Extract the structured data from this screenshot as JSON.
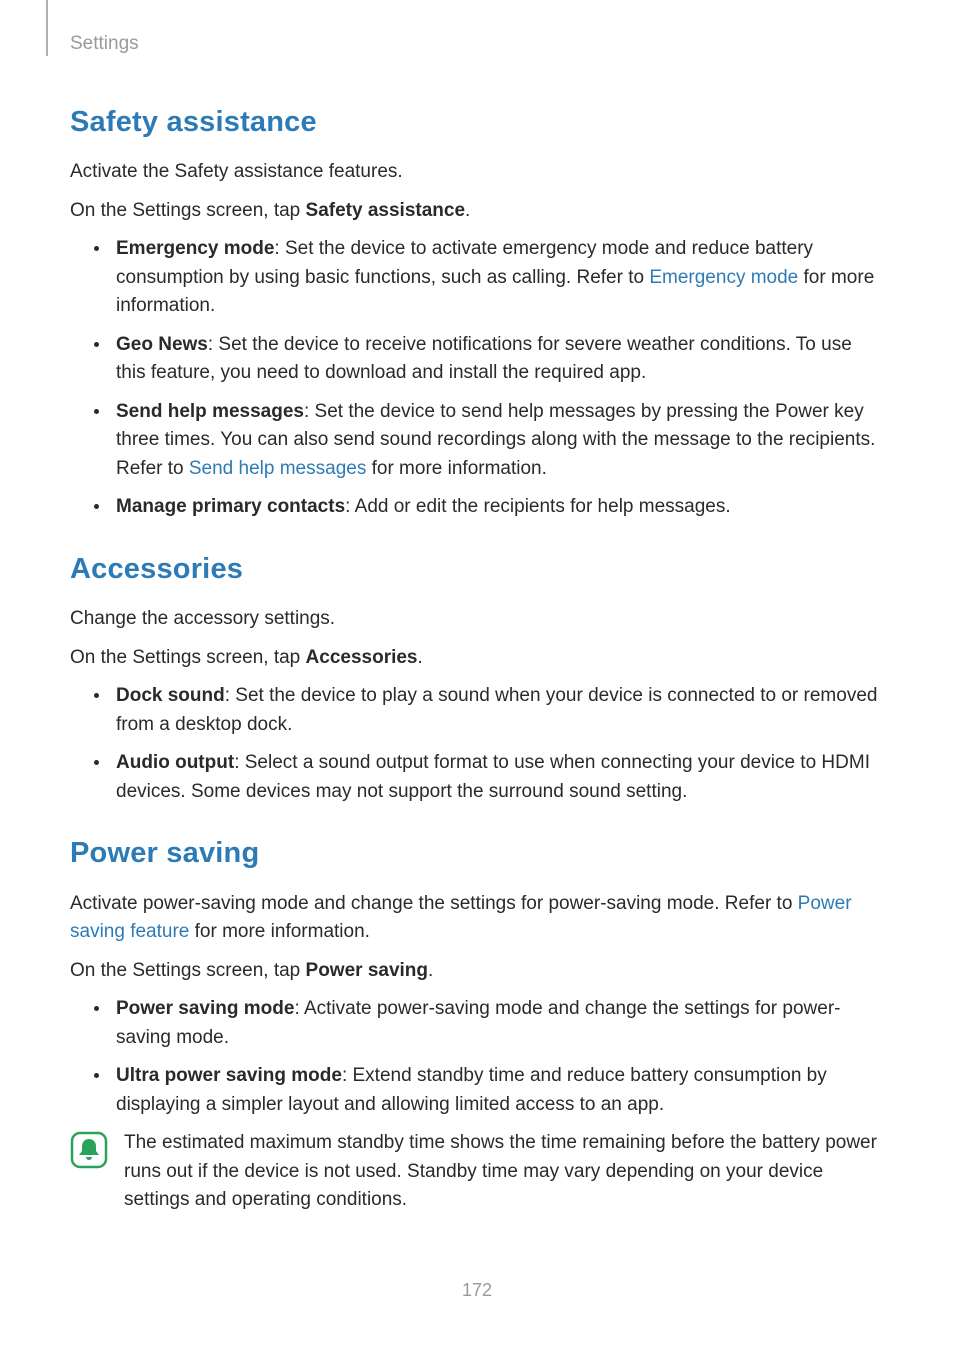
{
  "header": {
    "breadcrumb": "Settings"
  },
  "page_number": "172",
  "sections": {
    "safety": {
      "title": "Safety assistance",
      "intro": "Activate the Safety assistance features.",
      "nav_pre": "On the Settings screen, tap ",
      "nav_bold": "Safety assistance",
      "nav_post": ".",
      "items": {
        "emergency": {
          "label": "Emergency mode",
          "text_a": ": Set the device to activate emergency mode and reduce battery consumption by using basic functions, such as calling. Refer to ",
          "link": "Emergency mode",
          "text_b": " for more information."
        },
        "geo": {
          "label": "Geo News",
          "text": ": Set the device to receive notifications for severe weather conditions. To use this feature, you need to download and install the required app."
        },
        "send": {
          "label": "Send help messages",
          "text_a": ": Set the device to send help messages by pressing the Power key three times. You can also send sound recordings along with the message to the recipients. Refer to ",
          "link": "Send help messages",
          "text_b": " for more information."
        },
        "manage": {
          "label": "Manage primary contacts",
          "text": ": Add or edit the recipients for help messages."
        }
      }
    },
    "accessories": {
      "title": "Accessories",
      "intro": "Change the accessory settings.",
      "nav_pre": "On the Settings screen, tap ",
      "nav_bold": "Accessories",
      "nav_post": ".",
      "items": {
        "dock": {
          "label": "Dock sound",
          "text": ": Set the device to play a sound when your device is connected to or removed from a desktop dock."
        },
        "audio": {
          "label": "Audio output",
          "text": ": Select a sound output format to use when connecting your device to HDMI devices. Some devices may not support the surround sound setting."
        }
      }
    },
    "power": {
      "title": "Power saving",
      "intro_a": "Activate power-saving mode and change the settings for power-saving mode. Refer to ",
      "intro_link": "Power saving feature",
      "intro_b": " for more information.",
      "nav_pre": "On the Settings screen, tap ",
      "nav_bold": "Power saving",
      "nav_post": ".",
      "items": {
        "psm": {
          "label": "Power saving mode",
          "text": ": Activate power-saving mode and change the settings for power-saving mode."
        },
        "ultra": {
          "label": "Ultra power saving mode",
          "text": ": Extend standby time and reduce battery consumption by displaying a simpler layout and allowing limited access to an app."
        }
      },
      "note": "The estimated maximum standby time shows the time remaining before the battery power runs out if the device is not used. Standby time may vary depending on your device settings and operating conditions."
    }
  }
}
